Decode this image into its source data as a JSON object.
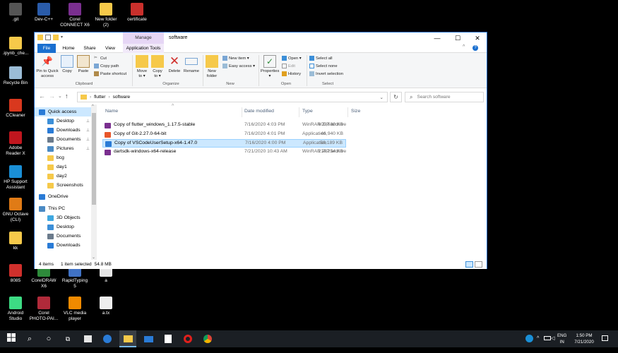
{
  "desktop": {
    "icons": [
      {
        "label": ".git",
        "color": "#555555"
      },
      {
        "label": "Dev-C++",
        "color": "#2a5caa"
      },
      {
        "label": "Corel\nCONNECT X6",
        "color": "#7a2f8f"
      },
      {
        "label": "New folder\n(2)",
        "color": "#f6c94a"
      },
      {
        "label": "certificate",
        "color": "#c9302c"
      },
      {
        "label": ".ipynb_che...",
        "color": "#f6c94a"
      },
      {
        "label": "Recycle Bin",
        "color": "#9bbcd6"
      },
      {
        "label": "CCleaner",
        "color": "#d9381e"
      },
      {
        "label": "Adobe\nReader X",
        "color": "#c0161e"
      },
      {
        "label": "HP Support\nAssistant",
        "color": "#1a8fd6"
      },
      {
        "label": "GNU Octave\n(CLI)",
        "color": "#e07b16"
      },
      {
        "label": "kk",
        "color": "#f6c94a"
      },
      {
        "label": "8085",
        "color": "#d0302c"
      },
      {
        "label": "CorelDRAW\nX6",
        "color": "#2e8b3b"
      },
      {
        "label": "RapidTyping\n5",
        "color": "#4072c4"
      },
      {
        "label": "a",
        "color": "#e6e6e6"
      },
      {
        "label": "Android\nStudio",
        "color": "#3ddc84"
      },
      {
        "label": "Corel\nPHOTO-PAI...",
        "color": "#b02a3a"
      },
      {
        "label": "VLC media\nplayer",
        "color": "#f08a00"
      },
      {
        "label": "a.tx",
        "color": "#eeeeee"
      }
    ]
  },
  "window": {
    "title": "software",
    "manage_tab": "Manage",
    "minimize": "—",
    "maximize": "☐",
    "close": "✕",
    "tabs": [
      "File",
      "Home",
      "Share",
      "View",
      "Application Tools"
    ]
  },
  "ribbon": {
    "pin_label": "Pin to Quick\naccess",
    "copy_label": "Copy",
    "paste_label": "Paste",
    "cut_label": "Cut",
    "copy_path_label": "Copy path",
    "paste_shortcut_label": "Paste shortcut",
    "clipboard_group": "Clipboard",
    "move_to_label": "Move\nto ▾",
    "copy_to_label": "Copy\nto ▾",
    "delete_label": "Delete",
    "rename_label": "Rename",
    "organize_group": "Organize",
    "new_folder_label": "New\nfolder",
    "new_item_label": "New item ▾",
    "easy_access_label": "Easy access ▾",
    "new_group": "New",
    "properties_label": "Properties\n▾",
    "open_label": "Open ▾",
    "edit_label": "Edit",
    "history_label": "History",
    "open_group": "Open",
    "select_all_label": "Select all",
    "select_none_label": "Select none",
    "invert_selection_label": "Invert selection",
    "select_group": "Select"
  },
  "address": {
    "back": "←",
    "forward": "→",
    "recent": "⌄",
    "up": "↑",
    "crumbs": [
      "flutter",
      "software"
    ],
    "dropdown": "⌄",
    "refresh": "↻",
    "search_placeholder": "Search software"
  },
  "nav": {
    "items": [
      {
        "label": "Quick access",
        "color": "#2a7bd6",
        "pinned": false
      },
      {
        "label": "Desktop",
        "color": "#3c8fd8",
        "pinned": true
      },
      {
        "label": "Downloads",
        "color": "#2a7bd6",
        "pinned": true
      },
      {
        "label": "Documents",
        "color": "#6b7b8c",
        "pinned": true
      },
      {
        "label": "Pictures",
        "color": "#4a8ac4",
        "pinned": true
      },
      {
        "label": "bcg",
        "color": "#f6c94a",
        "pinned": false
      },
      {
        "label": "day1",
        "color": "#f6c94a",
        "pinned": false
      },
      {
        "label": "day2",
        "color": "#f6c94a",
        "pinned": false
      },
      {
        "label": "Screenshots",
        "color": "#f6c94a",
        "pinned": false
      },
      {
        "label": "OneDrive",
        "color": "#2a7bd6",
        "pinned": false
      },
      {
        "label": "This PC",
        "color": "#4a8ac4",
        "pinned": false
      },
      {
        "label": "3D Objects",
        "color": "#3fa8e0",
        "pinned": false
      },
      {
        "label": "Desktop",
        "color": "#3c8fd8",
        "pinned": false
      },
      {
        "label": "Documents",
        "color": "#6b7b8c",
        "pinned": false
      },
      {
        "label": "Downloads",
        "color": "#2a7bd6",
        "pinned": false
      }
    ],
    "pin_glyph": "📌"
  },
  "files": {
    "columns": {
      "name": "Name",
      "date": "Date modified",
      "type": "Type",
      "size": "Size"
    },
    "rows": [
      {
        "name": "Copy of flutter_windows_1.17.5-stable",
        "date": "7/16/2020 4:03 PM",
        "type": "WinRAR ZIP archive",
        "size": "609,580 KB",
        "color": "#7a2f8f",
        "selected": false
      },
      {
        "name": "Copy of Git-2.27.0-64-bit",
        "date": "7/16/2020 4:01 PM",
        "type": "Application",
        "size": "46,940 KB",
        "color": "#e8572b",
        "selected": false
      },
      {
        "name": "Copy of VSCodeUserSetup-x64-1.47.0",
        "date": "7/16/2020 4:00 PM",
        "type": "Application",
        "size": "56,189 KB",
        "color": "#2a7bd6",
        "selected": true
      },
      {
        "name": "dartsdk-windows-x64-release",
        "date": "7/21/2020 10:43 AM",
        "type": "WinRAR ZIP archive",
        "size": "214,254 KB",
        "color": "#7a2f8f",
        "selected": false
      }
    ]
  },
  "status": {
    "count": "4 items",
    "selection": "1 item selected",
    "size": "54.8 MB"
  },
  "taskbar": {
    "lang_top": "ENG",
    "lang_bottom": "IN",
    "time": "1:50 PM",
    "date": "7/21/2020",
    "tray_chevron": "^"
  }
}
